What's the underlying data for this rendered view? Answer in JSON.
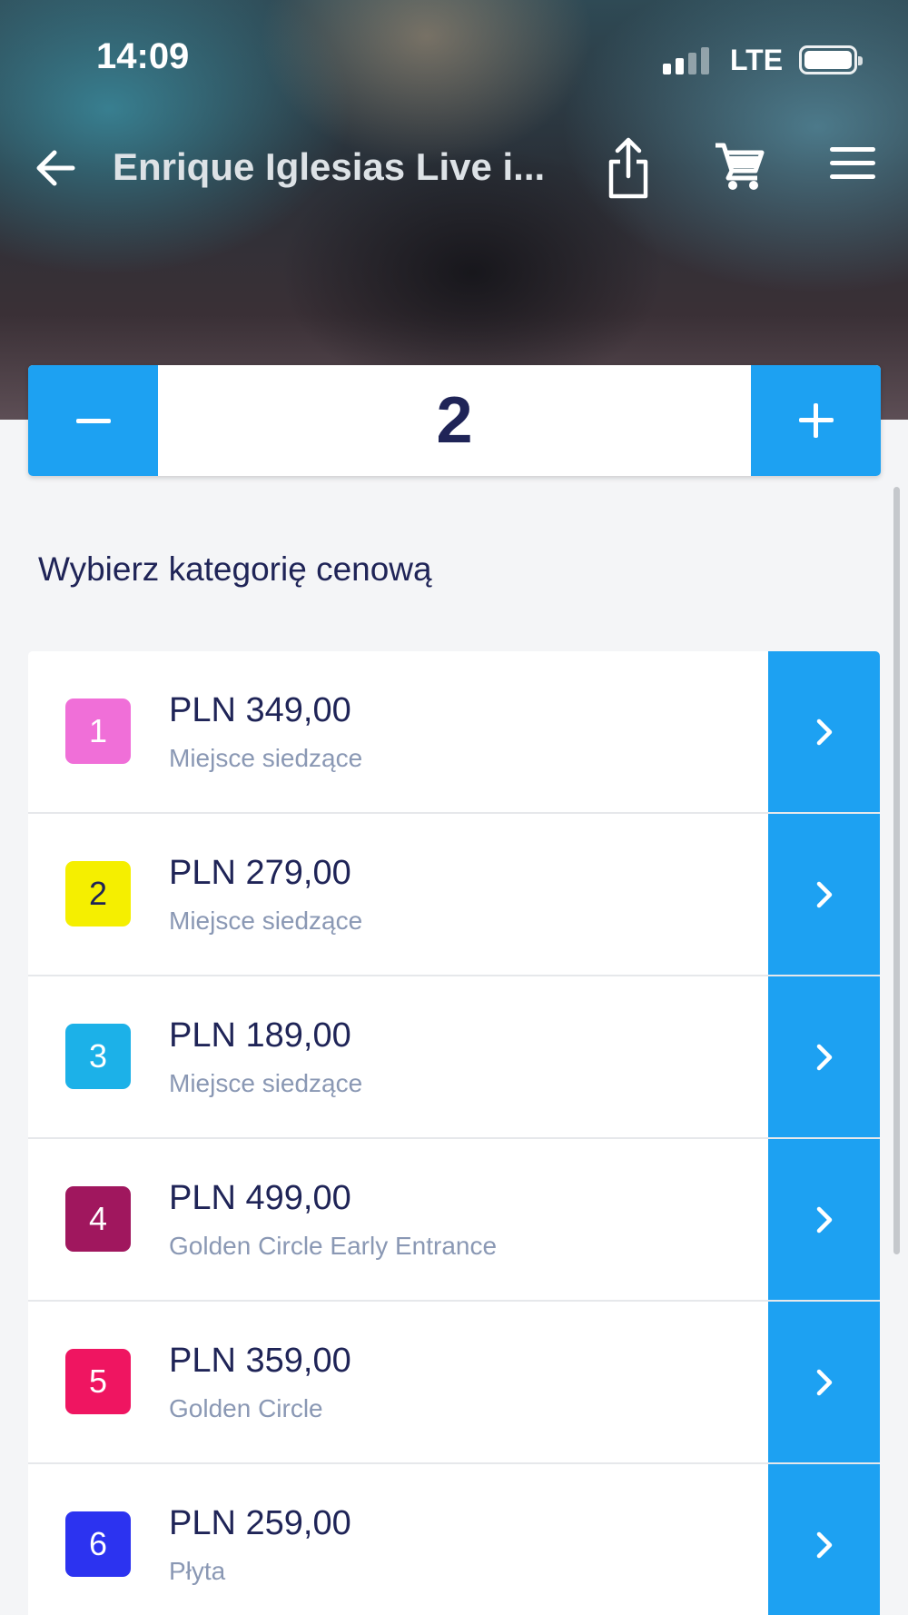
{
  "status_bar": {
    "time": "14:09",
    "network": "LTE"
  },
  "nav": {
    "title": "Enrique Iglesias Live i...",
    "icons": [
      "arrow-left-icon",
      "share-icon",
      "cart-icon",
      "hamburger-menu-icon"
    ]
  },
  "stepper": {
    "quantity": "2"
  },
  "section": {
    "heading": "Wybierz kategorię cenową"
  },
  "categories": [
    {
      "number": "1",
      "price": "PLN 349,00",
      "description": "Miejsce siedzące",
      "color": "#f06fd8",
      "text_color": "#ffffff"
    },
    {
      "number": "2",
      "price": "PLN 279,00",
      "description": "Miejsce siedzące",
      "color": "#f5ef00",
      "text_color": "#1f2457"
    },
    {
      "number": "3",
      "price": "PLN 189,00",
      "description": "Miejsce siedzące",
      "color": "#1cb1e8",
      "text_color": "#ffffff"
    },
    {
      "number": "4",
      "price": "PLN 499,00",
      "description": "Golden Circle Early Entrance",
      "color": "#a0175e",
      "text_color": "#ffffff"
    },
    {
      "number": "5",
      "price": "PLN 359,00",
      "description": "Golden Circle",
      "color": "#ef1561",
      "text_color": "#ffffff"
    },
    {
      "number": "6",
      "price": "PLN 259,00",
      "description": "Płyta",
      "color": "#2c33f0",
      "text_color": "#ffffff"
    }
  ],
  "colors": {
    "accent": "#1da1f2",
    "heading_text": "#1f2457",
    "secondary_text": "#8a98b4",
    "background": "#f4f5f7"
  }
}
